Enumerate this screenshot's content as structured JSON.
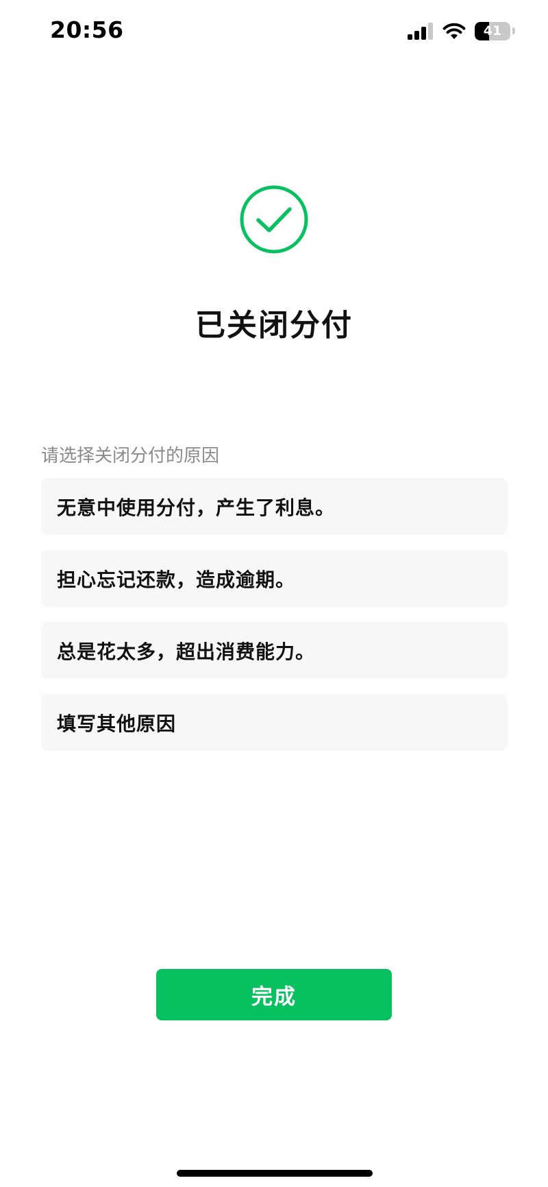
{
  "status_bar": {
    "time": "20:56",
    "battery_level": "41",
    "battery_fraction": 0.41
  },
  "result": {
    "icon": "check-circle-icon",
    "title": "已关闭分付"
  },
  "reasons": {
    "prompt": "请选择关闭分付的原因",
    "items": [
      {
        "label": "无意中使用分付，产生了利息。"
      },
      {
        "label": "担心忘记还款，造成逾期。"
      },
      {
        "label": "总是花太多，超出消费能力。"
      },
      {
        "label": "填写其他原因"
      }
    ]
  },
  "actions": {
    "done_label": "完成"
  },
  "colors": {
    "accent": "#07c160",
    "item_background": "#f7f7f7",
    "prompt_text": "#8a8a8a"
  }
}
